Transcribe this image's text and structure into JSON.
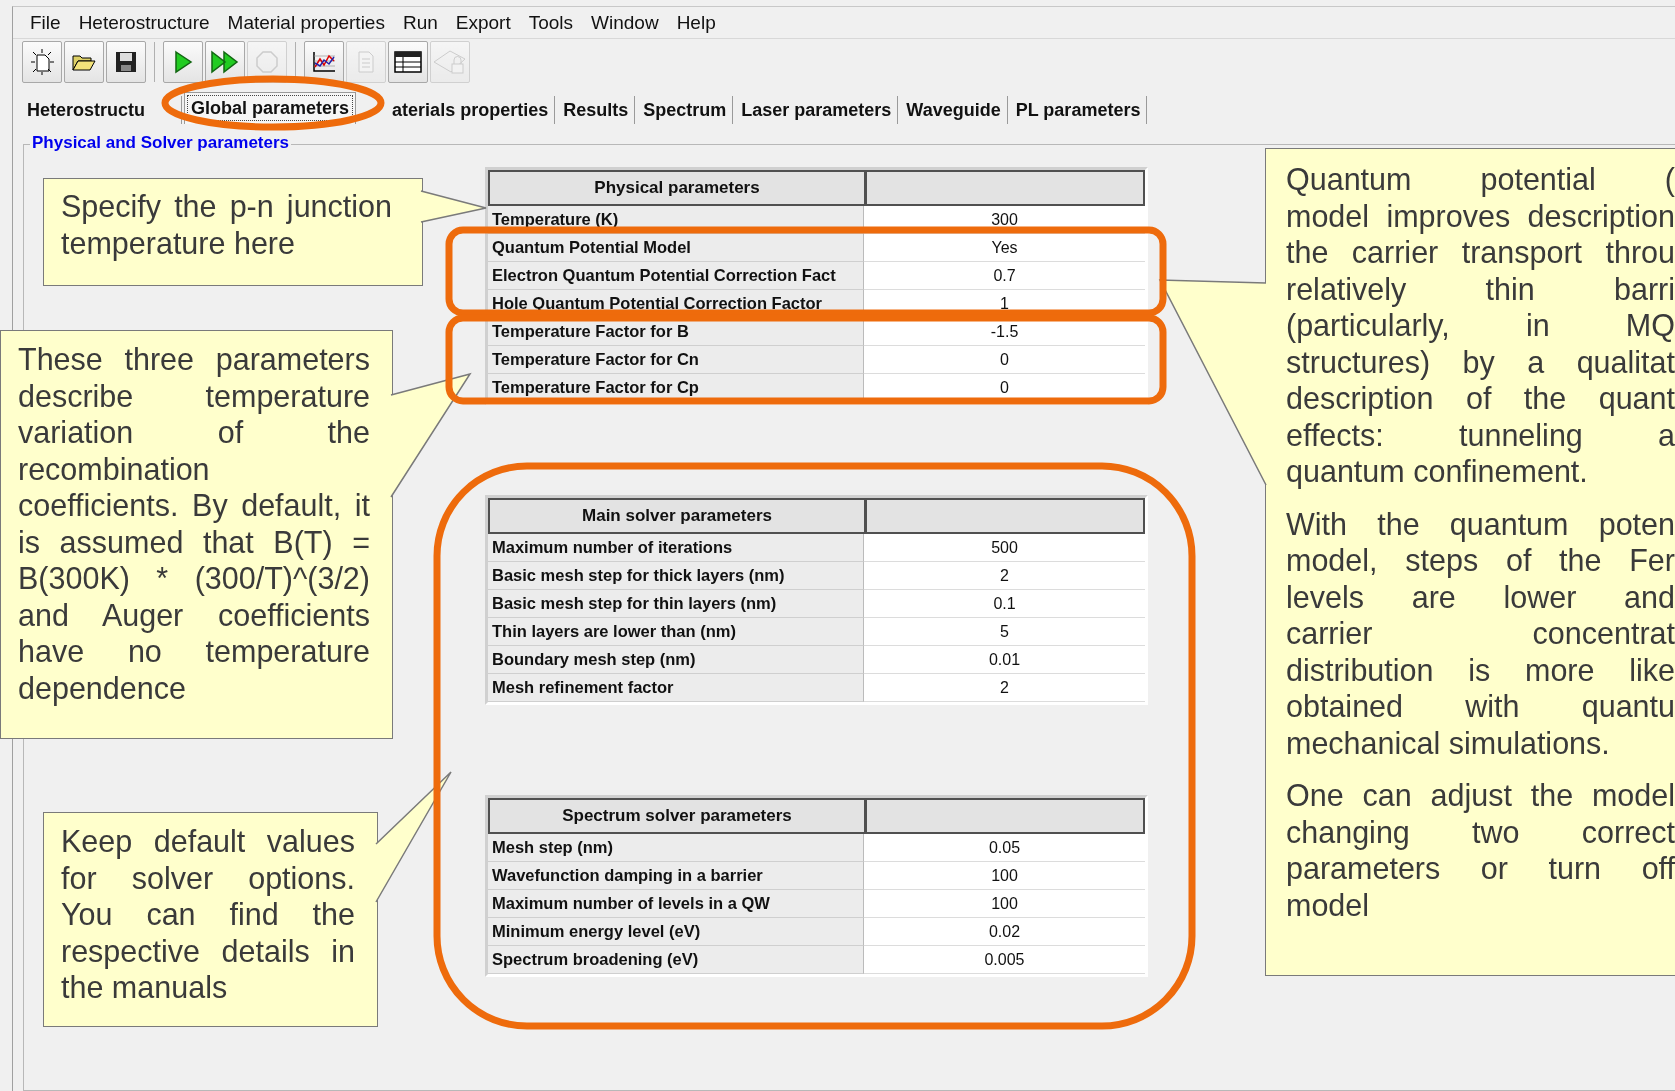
{
  "menu": [
    "File",
    "Heterostructure",
    "Material properties",
    "Run",
    "Export",
    "Tools",
    "Window",
    "Help"
  ],
  "toolbar": [
    {
      "kind": "new",
      "disabled": false
    },
    {
      "kind": "open",
      "disabled": false
    },
    {
      "kind": "save",
      "disabled": false
    },
    {
      "kind": "separator"
    },
    {
      "kind": "run",
      "disabled": false
    },
    {
      "kind": "run-all",
      "disabled": false
    },
    {
      "kind": "stop",
      "disabled": true
    },
    {
      "kind": "separator"
    },
    {
      "kind": "chart",
      "disabled": false
    },
    {
      "kind": "document",
      "disabled": true
    },
    {
      "kind": "table",
      "disabled": false
    },
    {
      "kind": "lock",
      "disabled": true
    }
  ],
  "tabs": [
    {
      "label": "Heterostructu",
      "selected": false
    },
    {
      "label": "Global parameters",
      "selected": true
    },
    {
      "label": "aterials properties",
      "selected": false
    },
    {
      "label": "Results",
      "selected": false
    },
    {
      "label": "Spectrum",
      "selected": false
    },
    {
      "label": "Laser parameters",
      "selected": false
    },
    {
      "label": "Waveguide",
      "selected": false
    },
    {
      "label": "PL parameters",
      "selected": false
    }
  ],
  "group_title": "Physical and Solver parameters",
  "tables": [
    {
      "title": "Physical parameters",
      "rows": [
        {
          "name": "Temperature (K)",
          "value": "300"
        },
        {
          "name": "Quantum Potential Model",
          "value": "Yes"
        },
        {
          "name": "Electron Quantum Potential Correction Fact",
          "value": "0.7"
        },
        {
          "name": "Hole Quantum Potential Correction Factor",
          "value": "1"
        },
        {
          "name": "Temperature Factor for B",
          "value": "-1.5"
        },
        {
          "name": "Temperature Factor for Cn",
          "value": "0"
        },
        {
          "name": "Temperature Factor for Cp",
          "value": "0"
        }
      ]
    },
    {
      "title": "Main solver parameters",
      "rows": [
        {
          "name": "Maximum number of iterations",
          "value": "500"
        },
        {
          "name": "Basic mesh step for thick layers (nm)",
          "value": "2"
        },
        {
          "name": "Basic mesh step for thin layers (nm)",
          "value": "0.1"
        },
        {
          "name": "Thin layers are lower than (nm)",
          "value": "5"
        },
        {
          "name": "Boundary mesh step (nm)",
          "value": "0.01"
        },
        {
          "name": "Mesh refinement factor",
          "value": "2"
        }
      ]
    },
    {
      "title": "Spectrum solver parameters",
      "rows": [
        {
          "name": "Mesh step (nm)",
          "value": "0.05"
        },
        {
          "name": "Wavefunction damping in a barrier",
          "value": "100"
        },
        {
          "name": "Maximum number of levels in a QW",
          "value": "100"
        },
        {
          "name": "Minimum energy level (eV)",
          "value": "0.02"
        },
        {
          "name": "Spectrum broadening (eV)",
          "value": "0.005"
        }
      ]
    }
  ],
  "callouts": [
    {
      "kind": "left",
      "paragraphs": [
        [
          "Specify the p-n junction temperature here"
        ]
      ]
    },
    {
      "kind": "left",
      "paragraphs": [
        [
          "These three parameters describe temperature variation of the recombination coefficients. By default, it is assumed that B(T) = B(300K) * (300/T)^(3/2) and Auger coefficients have no temperature dependence"
        ]
      ]
    },
    {
      "kind": "left",
      "paragraphs": [
        [
          "Keep default values for solver options. You can find the respective details in the manuals"
        ]
      ]
    },
    {
      "kind": "cut",
      "paragraphs": [
        [
          "Quantum potential (",
          "model improves description",
          "the carrier transport throu",
          "relatively thin barri",
          "(particularly, in MQ",
          "structures) by a qualitat",
          "description of the quant",
          "effects: tunneling a",
          "quantum confinement."
        ],
        [
          "With the quantum poten",
          "model, steps of the Fer",
          "levels are lower and",
          "carrier concentrat",
          "distribution is more like",
          "obtained with quantu",
          "mechanical simulations."
        ],
        [
          "One can adjust the model",
          "changing two correct",
          "parameters or turn off",
          "model"
        ]
      ]
    }
  ]
}
